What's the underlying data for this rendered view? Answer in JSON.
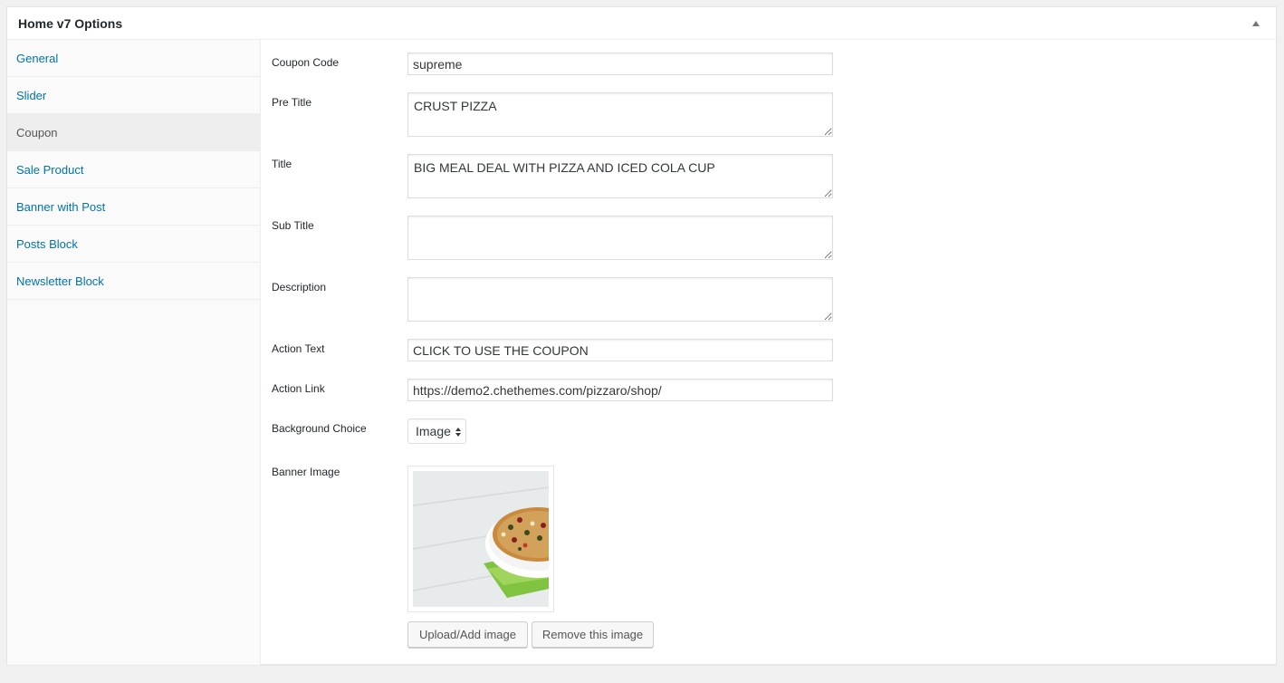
{
  "panel": {
    "title": "Home v7 Options"
  },
  "tabs": [
    {
      "label": "General"
    },
    {
      "label": "Slider"
    },
    {
      "label": "Coupon"
    },
    {
      "label": "Sale Product"
    },
    {
      "label": "Banner with Post"
    },
    {
      "label": "Posts Block"
    },
    {
      "label": "Newsletter Block"
    }
  ],
  "form": {
    "coupon_code": {
      "label": "Coupon Code",
      "value": "supreme"
    },
    "pre_title": {
      "label": "Pre Title",
      "value": "CRUST PIZZA"
    },
    "title": {
      "label": "Title",
      "value": "BIG MEAL DEAL WITH PIZZA AND ICED COLA CUP"
    },
    "sub_title": {
      "label": "Sub Title",
      "value": ""
    },
    "description": {
      "label": "Description",
      "value": ""
    },
    "action_text": {
      "label": "Action Text",
      "value": "CLICK TO USE THE COUPON"
    },
    "action_link": {
      "label": "Action Link",
      "value": "https://demo2.chethemes.com/pizzaro/shop/"
    },
    "background_choice": {
      "label": "Background Choice",
      "value": "Image"
    },
    "banner_image": {
      "label": "Banner Image"
    }
  },
  "buttons": {
    "upload": "Upload/Add image",
    "remove": "Remove this image"
  },
  "colors": {
    "link": "#0073aa",
    "active_tab_bg": "#eeeeee",
    "panel_bg": "#ffffff",
    "page_bg": "#f1f1f1"
  },
  "icons": {
    "toggle": "triangle-up-icon",
    "select": "select-arrows-icon"
  }
}
